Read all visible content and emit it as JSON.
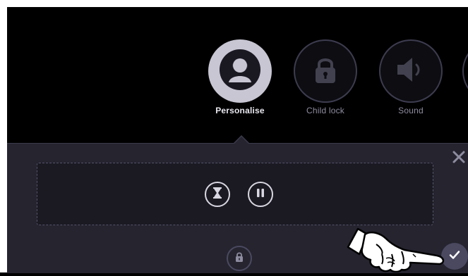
{
  "menu": {
    "items": [
      {
        "label": "Personalise",
        "icon": "person-icon",
        "selected": true
      },
      {
        "label": "Child lock",
        "icon": "lock-icon",
        "selected": false
      },
      {
        "label": "Sound",
        "icon": "speaker-icon",
        "selected": false
      }
    ]
  },
  "panel": {
    "close_icon": "close-icon",
    "controls": [
      "hourglass-icon",
      "pause-icon"
    ],
    "bottom_icon": "lock-icon",
    "confirm_icon": "checkmark-icon"
  },
  "overlay": {
    "icon": "pointing-hand-icon"
  },
  "colors": {
    "background": "#000000",
    "panel": "#25242f",
    "active_circle": "#c8c6d3",
    "inactive_border": "#3d3c4f"
  }
}
